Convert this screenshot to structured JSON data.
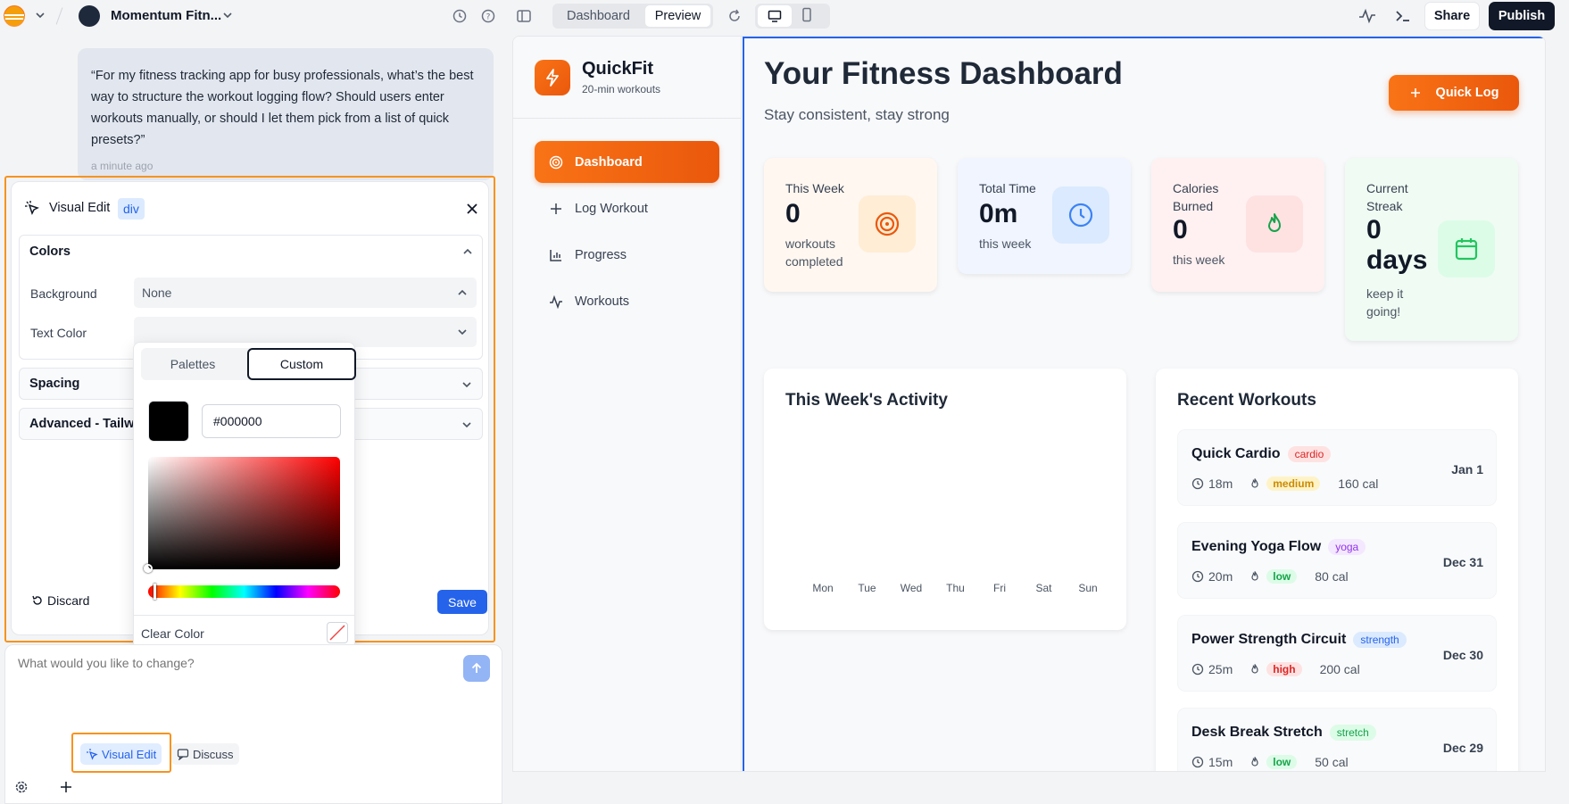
{
  "topbar": {
    "project_name": "Momentum Fitn...",
    "tab_dashboard": "Dashboard",
    "tab_preview": "Preview",
    "share_label": "Share",
    "publish_label": "Publish"
  },
  "chat": {
    "message": "“For my fitness tracking app for busy professionals, what’s the best way to structure the workout logging flow? Should users enter workouts manually, or should I let them pick from a list of quick presets?”",
    "time": "a minute ago"
  },
  "visual_edit": {
    "title": "Visual Edit",
    "element_tag": "div",
    "colors_label": "Colors",
    "background_label": "Background",
    "background_value": "None",
    "text_color_label": "Text Color",
    "spacing_label": "Spacing",
    "advanced_label": "Advanced - Tailw",
    "discard_label": "Discard",
    "save_label": "Save",
    "picker": {
      "tab_palettes": "Palettes",
      "tab_custom": "Custom",
      "hex_value": "#000000",
      "clear_label": "Clear Color",
      "current_color": "#000000"
    }
  },
  "prompt": {
    "placeholder": "What would you like to change?",
    "visual_edit_label": "Visual Edit",
    "discuss_label": "Discuss"
  },
  "app": {
    "brand": "QuickFit",
    "tagline": "20-min workouts",
    "nav": [
      "Dashboard",
      "Log Workout",
      "Progress",
      "Workouts"
    ],
    "title": "Your Fitness Dashboard",
    "subtitle": "Stay consistent, stay strong",
    "quick_log_label": "Quick Log",
    "stats": [
      {
        "label": "This Week",
        "value": "0",
        "sub": "workouts completed",
        "icon": "target-icon",
        "color": "#ea580c"
      },
      {
        "label": "Total Time",
        "value": "0m",
        "sub": "this week",
        "icon": "clock-icon",
        "color": "#3b82f6"
      },
      {
        "label": "Calories Burned",
        "value": "0",
        "sub": "this week",
        "icon": "flame-icon",
        "color": "#16a34a"
      },
      {
        "label": "Current Streak",
        "value": "0 days",
        "sub": "keep it going!",
        "icon": "calendar-icon",
        "color": "#22c55e"
      }
    ],
    "activity_title": "This Week's Activity",
    "days": [
      "Mon",
      "Tue",
      "Wed",
      "Thu",
      "Fri",
      "Sat",
      "Sun"
    ],
    "recent_title": "Recent Workouts",
    "workouts": [
      {
        "name": "Quick Cardio",
        "type": "cardio",
        "duration": "18m",
        "intensity": "medium",
        "calories": "160 cal",
        "date": "Jan 1"
      },
      {
        "name": "Evening Yoga Flow",
        "type": "yoga",
        "duration": "20m",
        "intensity": "low",
        "calories": "80 cal",
        "date": "Dec 31"
      },
      {
        "name": "Power Strength Circuit",
        "type": "strength",
        "duration": "25m",
        "intensity": "high",
        "calories": "200 cal",
        "date": "Dec 30"
      },
      {
        "name": "Desk Break Stretch",
        "type": "stretch",
        "duration": "15m",
        "intensity": "low",
        "calories": "50 cal",
        "date": "Dec 29"
      }
    ]
  },
  "colors": {
    "accent": "#f97316",
    "highlight": "#f7931e",
    "selection": "#2563eb",
    "publish_bg": "#111827"
  }
}
